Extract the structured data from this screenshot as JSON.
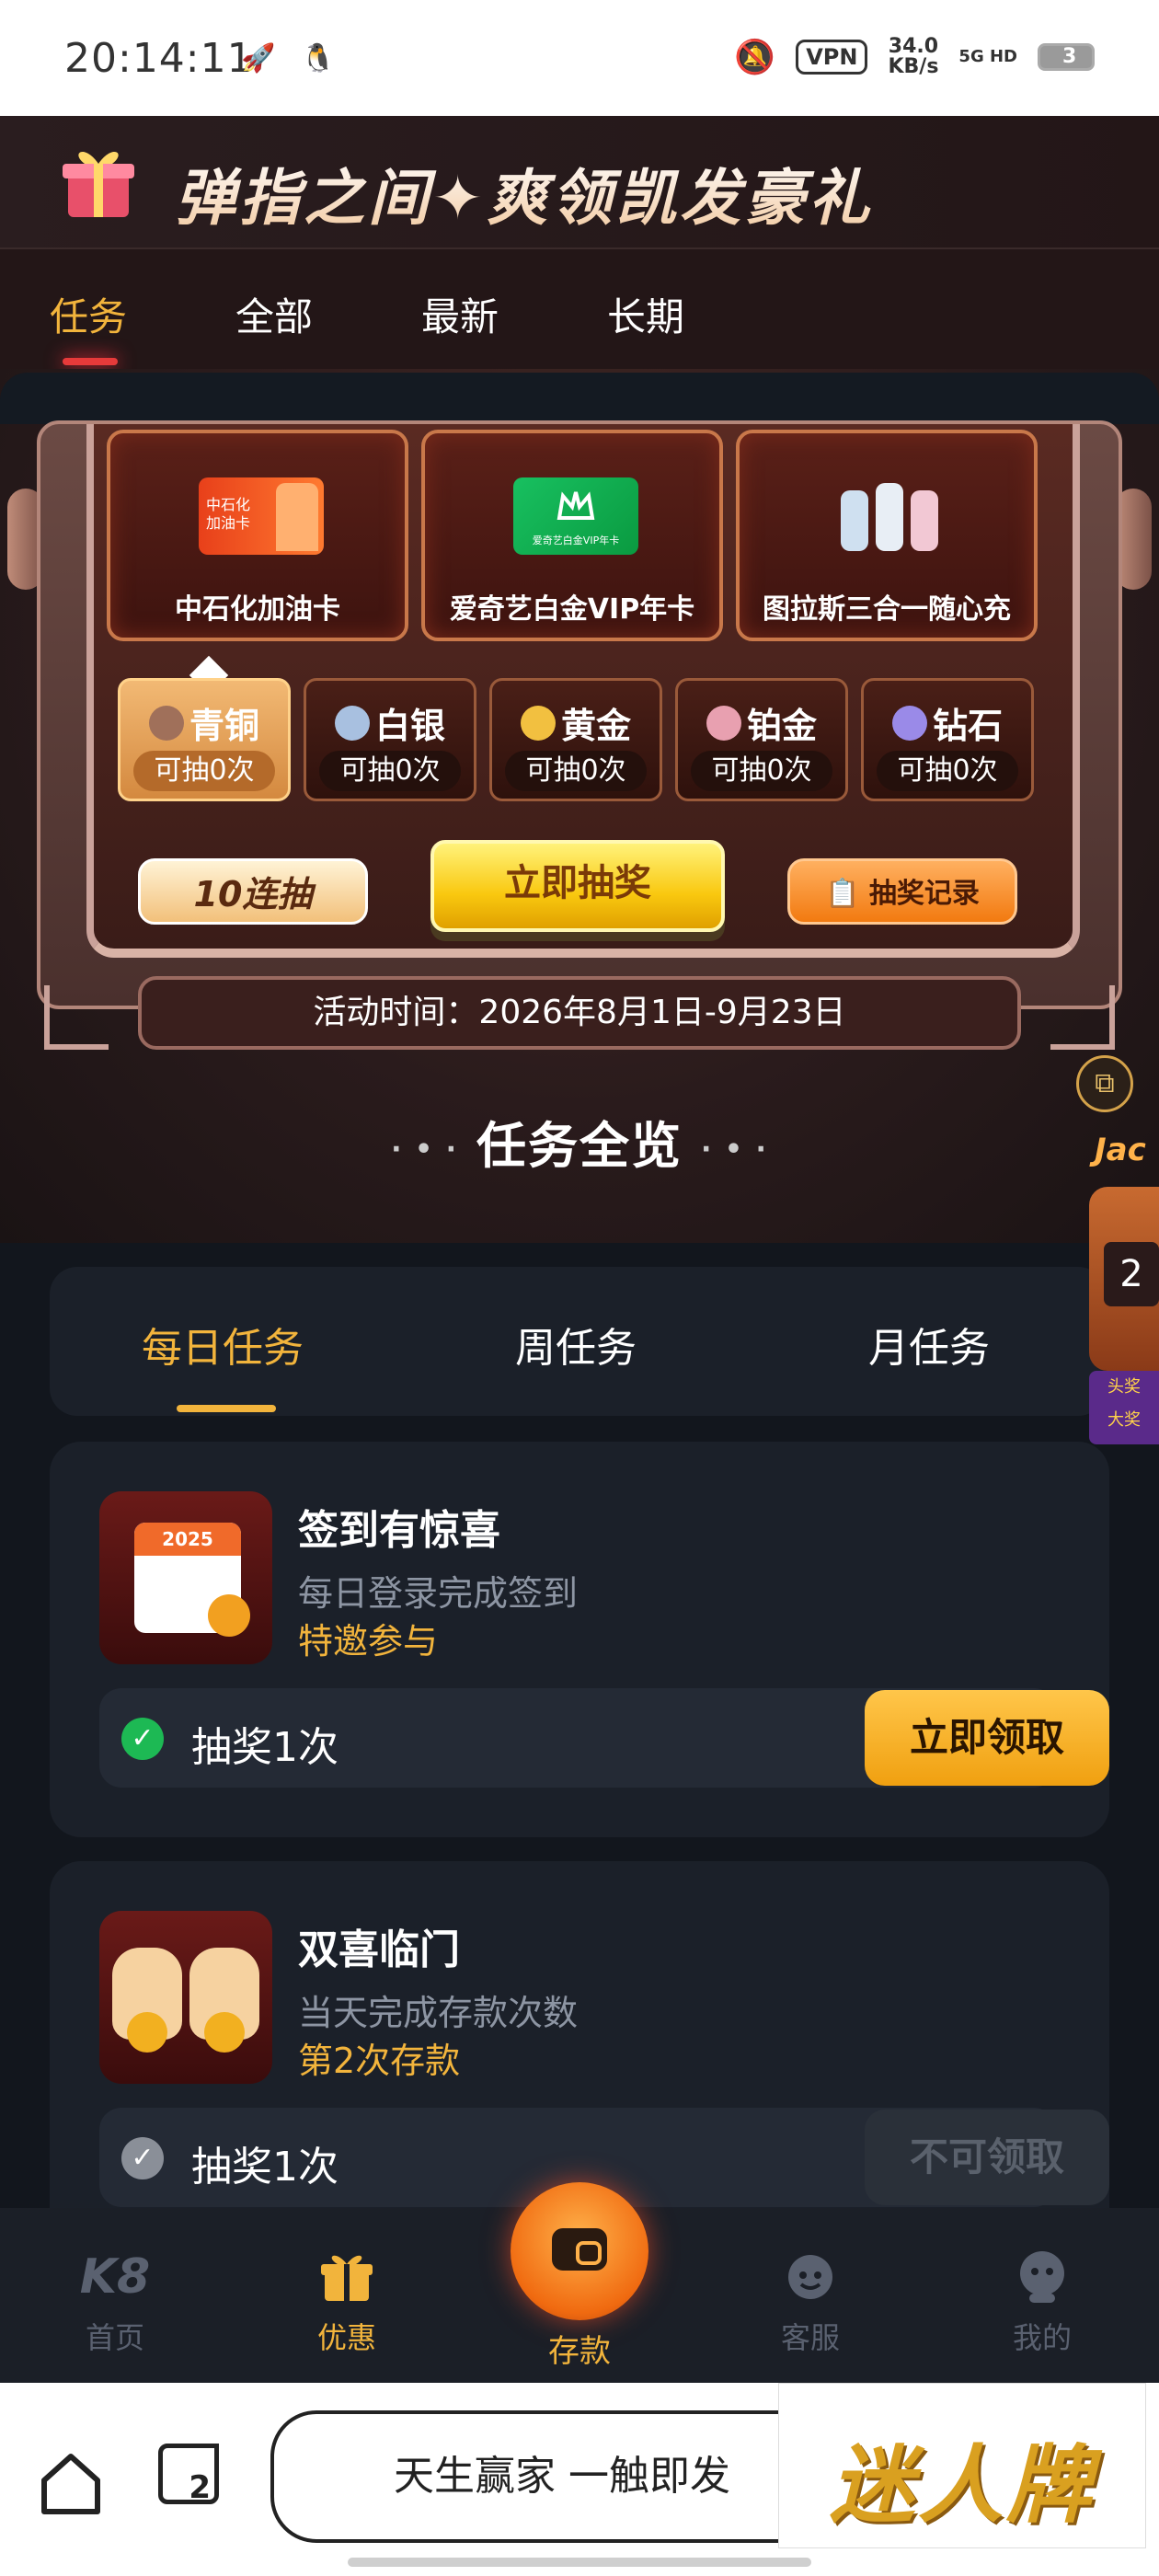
{
  "status_bar": {
    "time": "20:14:11",
    "vpn": "VPN",
    "speed_value": "34.0",
    "speed_unit": "KB/s",
    "network": "5G HD",
    "battery": "3"
  },
  "header": {
    "title": "弹指之间✦爽领凯发豪礼"
  },
  "top_tabs": [
    {
      "label": "任务"
    },
    {
      "label": "全部"
    },
    {
      "label": "最新"
    },
    {
      "label": "长期"
    }
  ],
  "prizes": [
    {
      "label": "中石化加油卡",
      "card_text": "中石化\n加油卡"
    },
    {
      "label": "爱奇艺白金VIP年卡",
      "card_text": "爱奇艺白金VIP年卡"
    },
    {
      "label": "图拉斯三合一随心充"
    }
  ],
  "tiers": [
    {
      "name": "青铜",
      "count": "可抽0次",
      "color": "#a0705a"
    },
    {
      "name": "白银",
      "count": "可抽0次",
      "color": "#a8c0e0"
    },
    {
      "name": "黄金",
      "count": "可抽0次",
      "color": "#f2c040"
    },
    {
      "name": "铂金",
      "count": "可抽0次",
      "color": "#e8a0b0"
    },
    {
      "name": "钻石",
      "count": "可抽0次",
      "color": "#9a8ae8"
    }
  ],
  "buttons": {
    "ten_draw": "10连抽",
    "draw_now": "立即抽奖",
    "draw_record": "抽奖记录"
  },
  "activity_time": "活动时间：2026年8月1日-9月23日",
  "overview_title": "任务全览",
  "task_tabs": [
    {
      "label": "每日任务"
    },
    {
      "label": "周任务"
    },
    {
      "label": "月任务"
    }
  ],
  "tasks": [
    {
      "title": "签到有惊喜",
      "desc": "每日登录完成签到",
      "note": "特邀参与",
      "reward": "抽奖1次",
      "action": "立即领取",
      "calendar_year": "2025"
    },
    {
      "title": "双喜临门",
      "desc": "当天完成存款次数",
      "note": "第2次存款",
      "reward": "抽奖1次",
      "action": "不可领取"
    }
  ],
  "jackpot": {
    "label": "Jac",
    "digit": "2",
    "sub1": "头奖",
    "sub2": "大奖"
  },
  "bottom_nav": [
    {
      "label": "首页",
      "logo": "K8"
    },
    {
      "label": "优惠"
    },
    {
      "label": "存款"
    },
    {
      "label": "客服"
    },
    {
      "label": "我的"
    }
  ],
  "browser": {
    "url_text": "天生赢家 一触即发",
    "tab_count": "2",
    "ad_text": "迷人牌"
  },
  "colors": {
    "accent": "#f2b43c",
    "bg": "#12161d",
    "card": "#1b2029",
    "muted": "#8d95a3"
  }
}
